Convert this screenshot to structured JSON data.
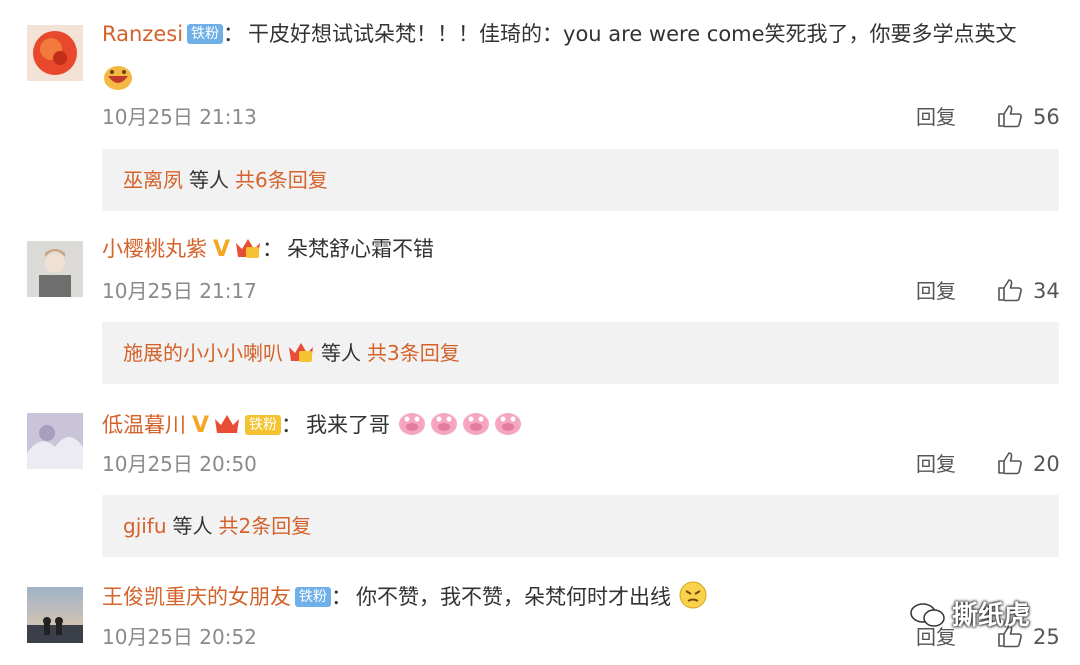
{
  "comments": [
    {
      "username": "Ranzesi",
      "badge": "铁粉",
      "text": "干皮好想试试朵梵！！！佳琦的：you are were come笑死我了，你要多学点英文",
      "time": "10月25日 21:13",
      "reply_label": "回复",
      "likes": "56",
      "sub": {
        "user": "巫离夙",
        "mid": "等人",
        "count": "共6条回复"
      }
    },
    {
      "username": "小樱桃丸紫",
      "text": "朵梵舒心霜不错",
      "time": "10月25日 21:17",
      "reply_label": "回复",
      "likes": "34",
      "sub": {
        "user": "施展的小小小喇叭",
        "mid": "等人",
        "count": "共3条回复"
      }
    },
    {
      "username": "低温暮川",
      "badge": "铁粉",
      "text": "我来了哥",
      "time": "10月25日 20:50",
      "reply_label": "回复",
      "likes": "20",
      "sub": {
        "user": "gjifu",
        "mid": "等人",
        "count": "共2条回复"
      }
    },
    {
      "username": "王俊凯重庆的女朋友",
      "badge": "铁粉",
      "text": "你不赞，我不赞，朵梵何时才出线",
      "time": "10月25日 20:52",
      "reply_label": "回复",
      "likes": "25"
    }
  ],
  "watermark": "撕纸虎",
  "colors": {
    "username": "#d4622a",
    "badge_blue": "#6fb0e8",
    "v_badge": "#f5a623",
    "reply_bg": "#f2f2f2"
  }
}
